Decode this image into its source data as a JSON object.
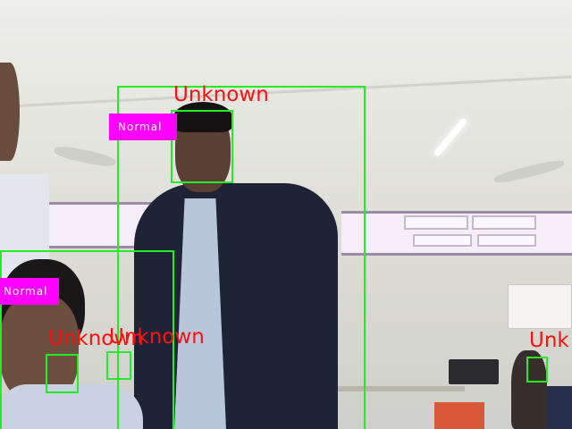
{
  "detections": {
    "unknown_text": "Unknown",
    "unknown_text_clipped": "Unk",
    "normal_text": "Normal"
  },
  "colors": {
    "box": "#22ee22",
    "label_text": "#ff1010",
    "tag_bg": "#ff00ff"
  }
}
